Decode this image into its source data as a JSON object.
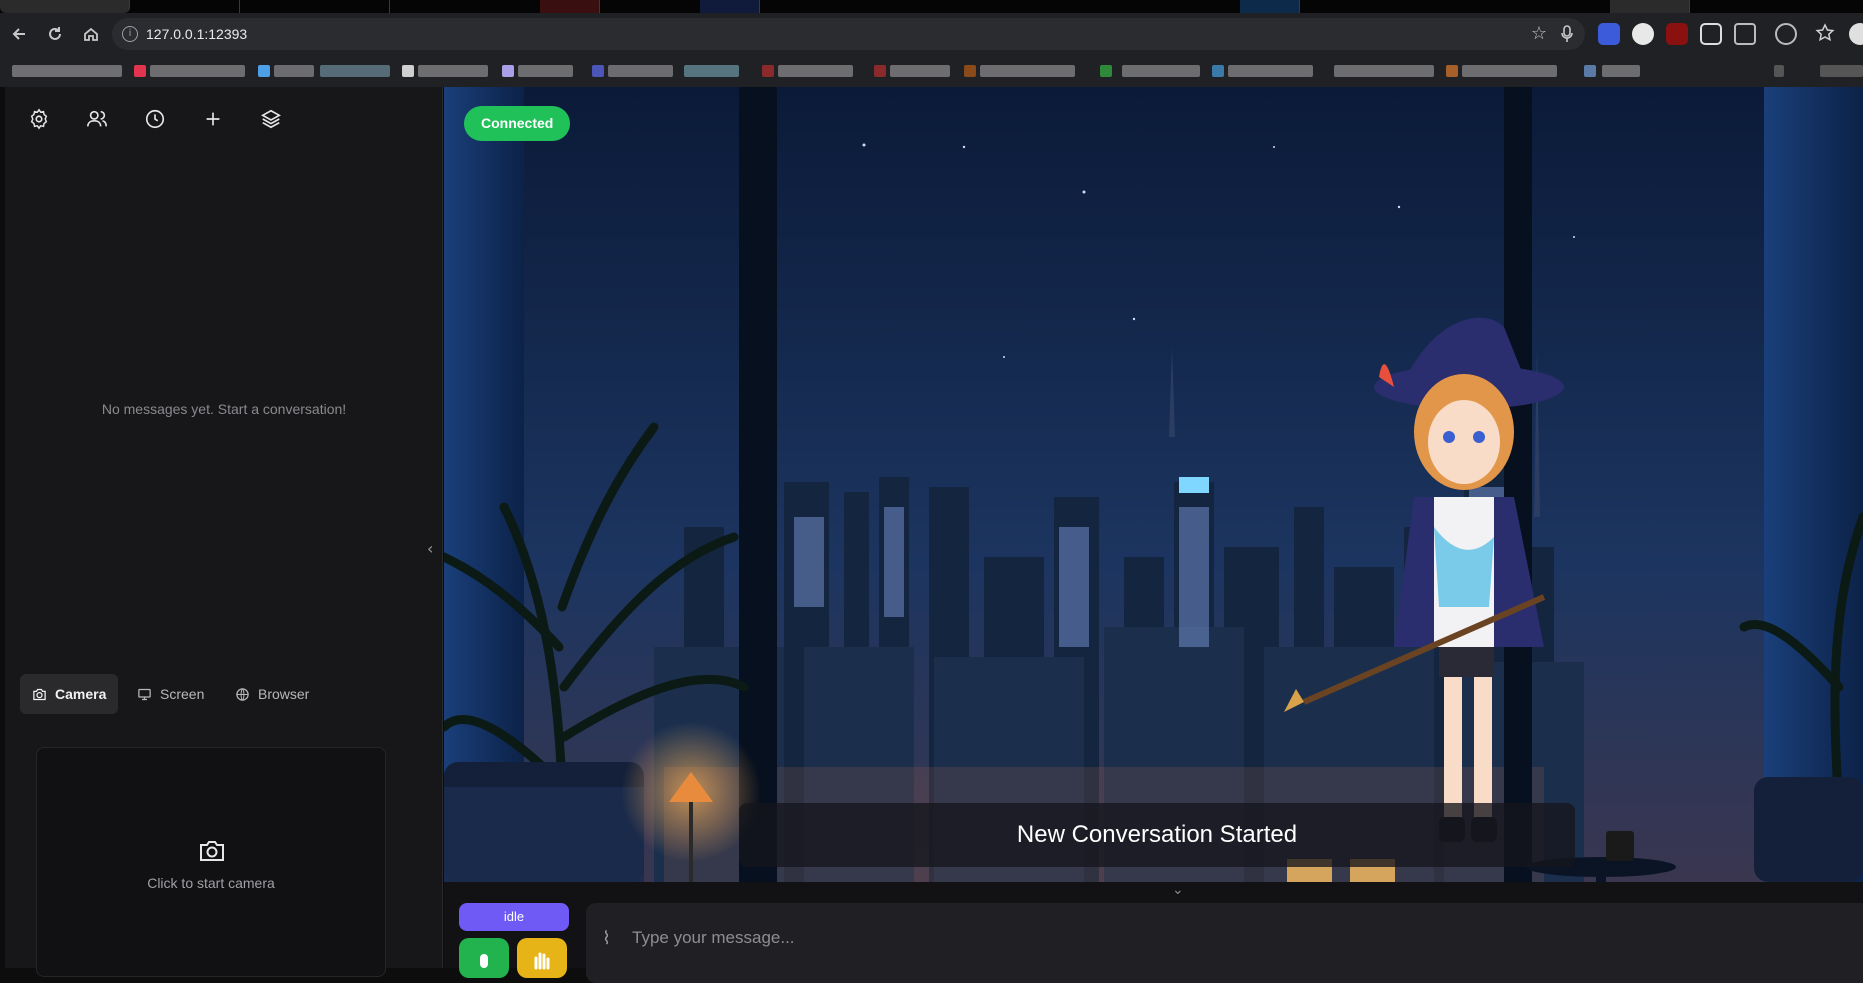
{
  "browser": {
    "url": "127.0.0.1:12393",
    "nav": {
      "back_icon": "arrow-left-icon",
      "reload_icon": "reload-icon",
      "home_icon": "home-icon"
    }
  },
  "sidebar": {
    "icons": [
      "gear-icon",
      "users-icon",
      "clock-icon",
      "plus-icon",
      "layers-icon"
    ],
    "empty_message": "No messages yet. Start a conversation!",
    "media_tabs": [
      {
        "label": "Camera",
        "icon": "camera-icon",
        "active": true
      },
      {
        "label": "Screen",
        "icon": "monitor-icon",
        "active": false
      },
      {
        "label": "Browser",
        "icon": "globe-icon",
        "active": false
      }
    ],
    "camera_prompt": "Click to start camera"
  },
  "stage": {
    "status_badge": "Connected",
    "subtitle": "New Conversation Started"
  },
  "input": {
    "state_badge": "idle",
    "placeholder": "Type your message..."
  },
  "colors": {
    "connected": "#21c15a",
    "idle": "#6f5af6",
    "mic": "#22b34e",
    "hand": "#e6b417"
  }
}
